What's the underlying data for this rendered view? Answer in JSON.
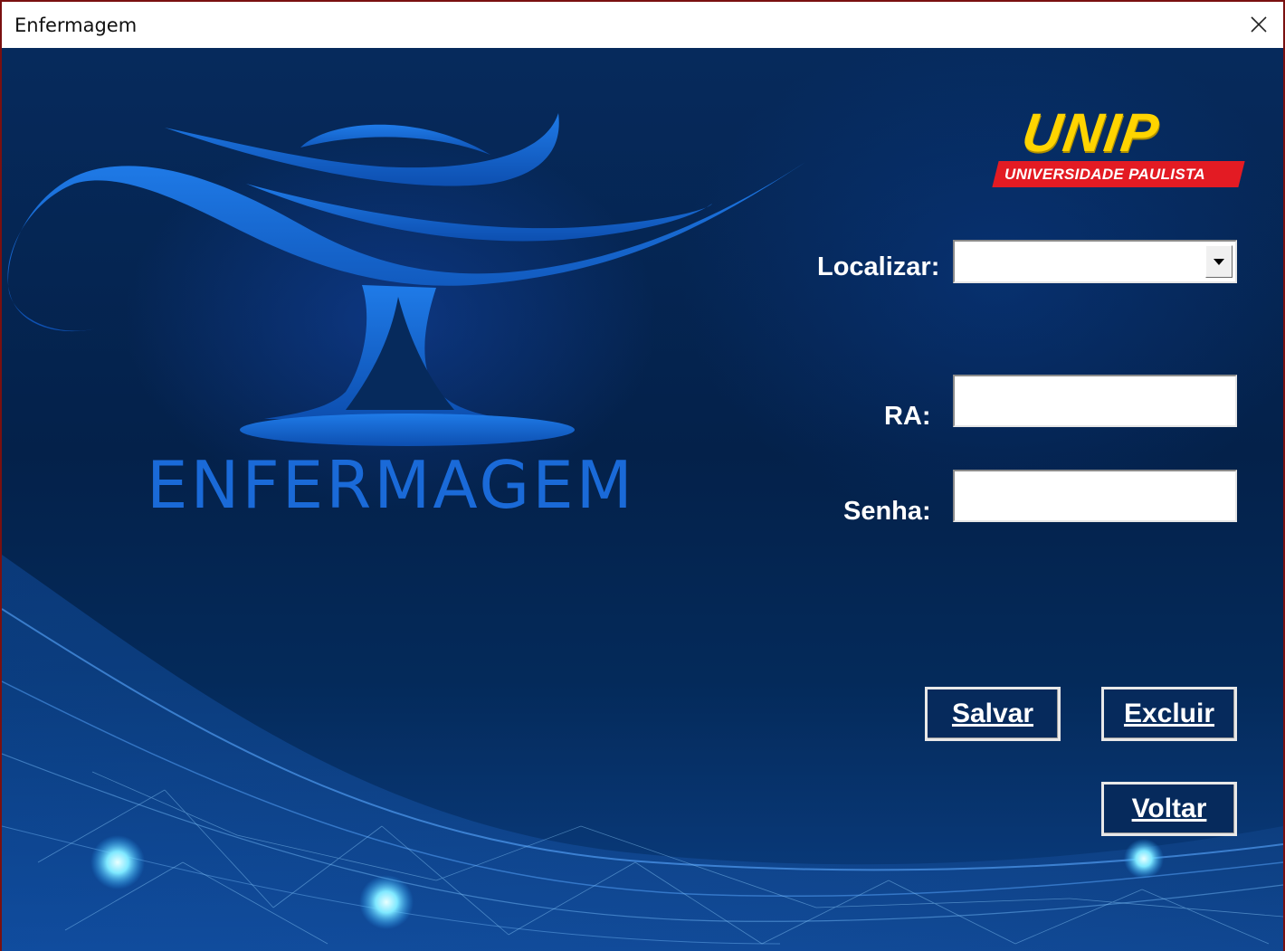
{
  "window": {
    "title": "Enfermagem"
  },
  "colors": {
    "background_dark": "#04214a",
    "logo_yellow": "#ffd400",
    "logo_red": "#e31b23",
    "emblem_blue": "#1a6ad8"
  },
  "branding": {
    "emblem_text": "ENFERMAGEM",
    "university_logo": "UNIP",
    "university_name": "UNIVERSIDADE PAULISTA"
  },
  "form": {
    "localizar_label": "Localizar:",
    "localizar_value": "",
    "ra_label": "RA:",
    "ra_value": "",
    "senha_label": "Senha:",
    "senha_value": ""
  },
  "buttons": {
    "salvar": "Salvar",
    "excluir": "Excluir",
    "voltar": "Voltar"
  },
  "icons": {
    "close": "close-icon",
    "dropdown": "chevron-down-icon",
    "emblem": "nursing-lamp-icon"
  }
}
